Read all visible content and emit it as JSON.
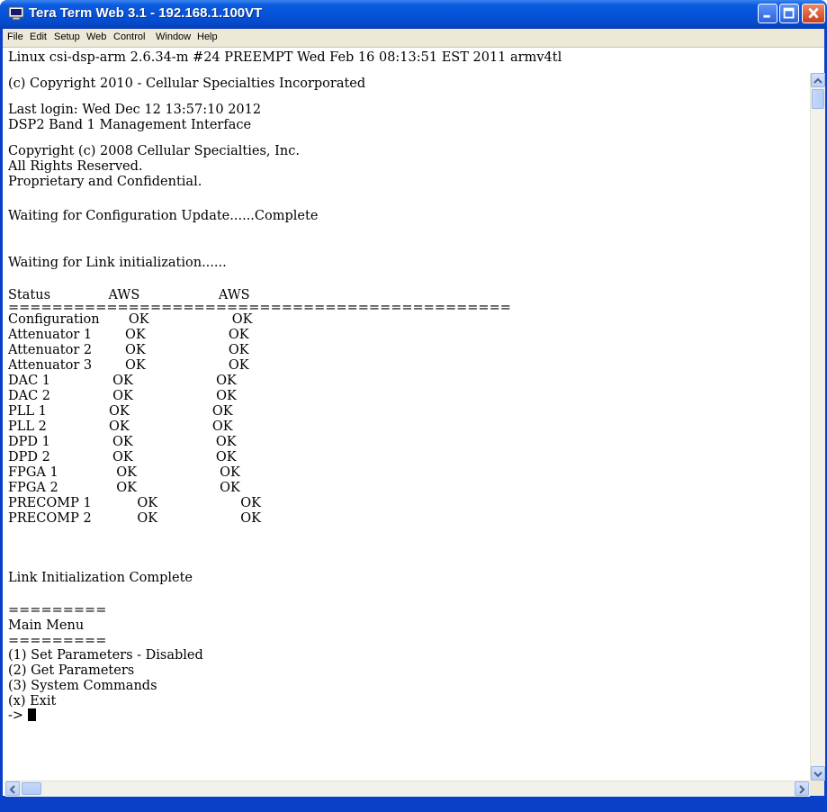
{
  "window": {
    "title": "Tera Term Web 3.1 - 192.168.1.100VT"
  },
  "menu": [
    "File",
    "Edit",
    "Setup",
    "Web",
    "Control",
    "Window",
    "Help"
  ],
  "terminal": {
    "lines": [
      "Linux csi-dsp-arm 2.6.34-m #24 PREEMPT Wed Feb 16 08:13:51 EST 2011 armv4tl",
      "(c) Copyright 2010 - Cellular Specialties Incorporated",
      "Last login: Wed Dec 12 13:57:10 2012",
      "DSP2 Band 1 Management Interface",
      "Copyright (c) 2008 Cellular Specialties, Inc.",
      "All Rights Reserved.",
      "Proprietary and Confidential.",
      "Waiting for Configuration Update......Complete",
      "Waiting for Link initialization......",
      "Status              AWS                   AWS",
      "==============================================",
      "Configuration       OK                    OK",
      "Attenuator 1        OK                    OK",
      "Attenuator 2        OK                    OK",
      "Attenuator 3        OK                    OK",
      "DAC 1               OK                    OK",
      "DAC 2               OK                    OK",
      "PLL 1               OK                    OK",
      "PLL 2               OK                    OK",
      "DPD 1               OK                    OK",
      "DPD 2               OK                    OK",
      "FPGA 1              OK                    OK",
      "FPGA 2              OK                    OK",
      "PRECOMP 1           OK                    OK",
      "PRECOMP 2           OK                    OK",
      "Link Initialization Complete",
      "=========",
      "Main Menu",
      "=========",
      "(1) Set Parameters - Disabled",
      "(2) Get Parameters",
      "(3) System Commands",
      "(x) Exit",
      "-> "
    ]
  },
  "colors": {
    "titlebar": "#0553d9",
    "menubar": "#ece9d8",
    "terminal_bg": "#ffffff",
    "terminal_fg": "#000000"
  },
  "icons": [
    "terminal-app-icon",
    "minimize-icon",
    "maximize-icon",
    "close-icon",
    "scroll-up-icon",
    "scroll-down-icon",
    "scroll-left-icon",
    "scroll-right-icon"
  ]
}
